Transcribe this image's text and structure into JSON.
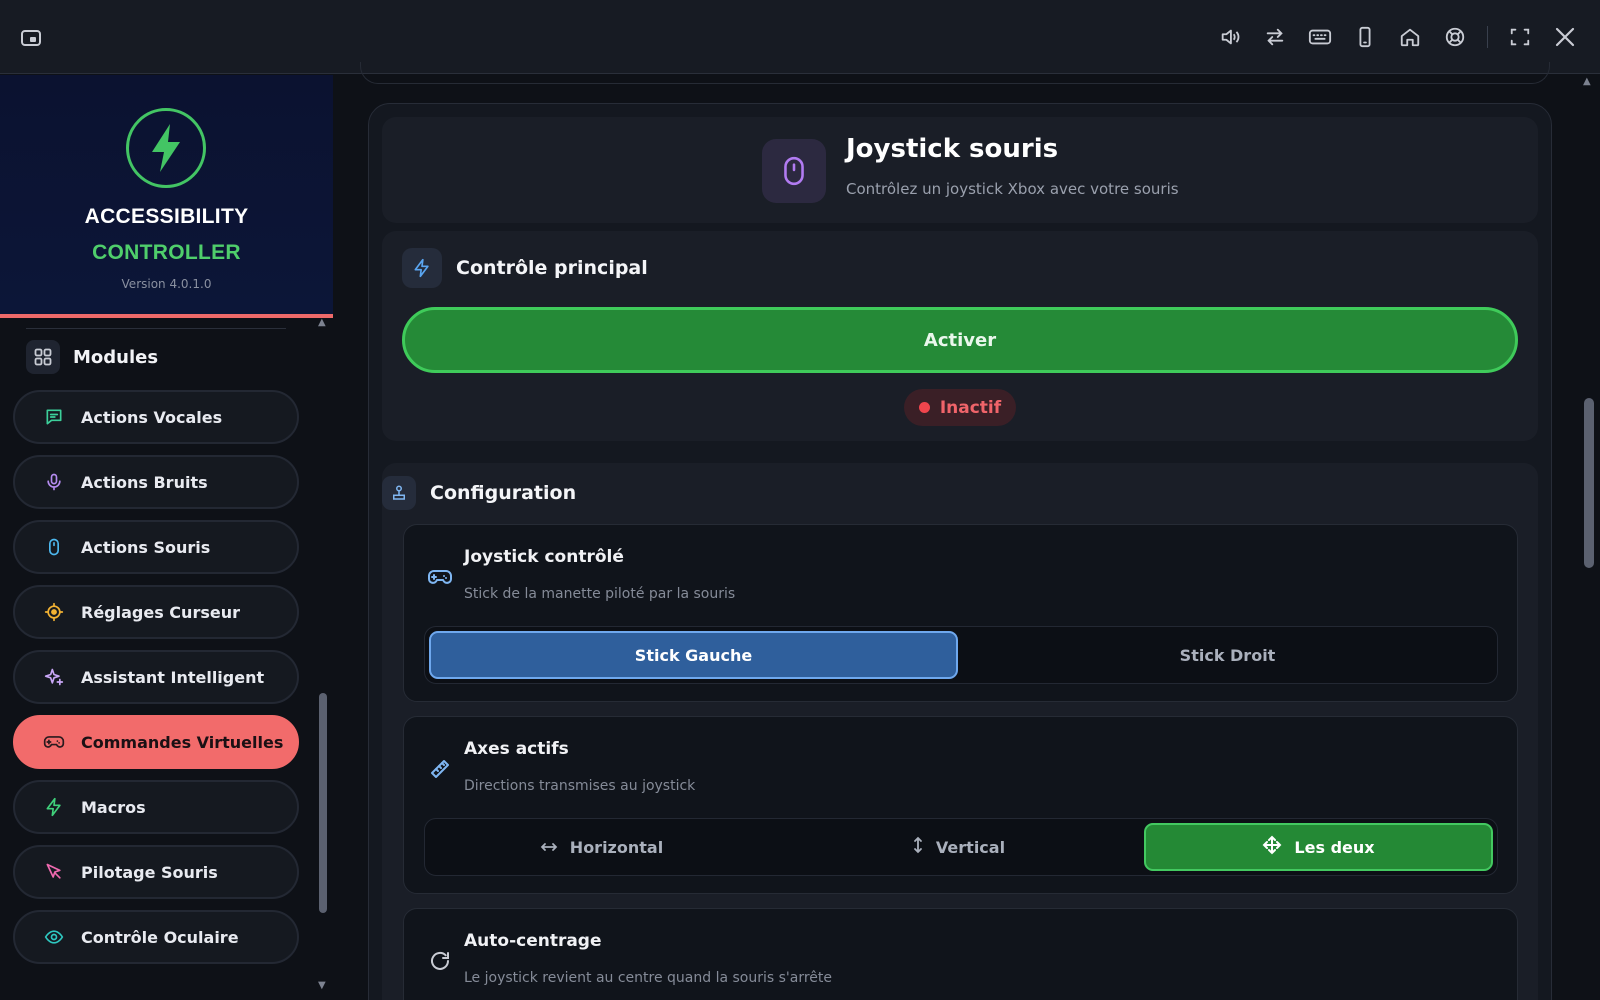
{
  "window": {
    "toolbar_icons": [
      "volume-icon",
      "swap-icon",
      "keyboard-icon",
      "phone-icon",
      "home-icon",
      "lifebuoy-icon",
      "fullscreen-icon",
      "close-icon"
    ]
  },
  "brand": {
    "title_line1": "ACCESSIBILITY",
    "title_line2": "CONTROLLER",
    "version": "Version 4.0.1.0",
    "accent": "#4fce6b"
  },
  "sidebar": {
    "section_label": "Modules",
    "items": [
      {
        "label": "Actions Vocales",
        "icon": "chat-icon",
        "icon_color": "#3ccf9a",
        "active": false
      },
      {
        "label": "Actions Bruits",
        "icon": "microphone-icon",
        "icon_color": "#b58cf0",
        "active": false
      },
      {
        "label": "Actions Souris",
        "icon": "mouse-icon",
        "icon_color": "#4db8ef",
        "active": false
      },
      {
        "label": "Réglages Curseur",
        "icon": "crosshair-icon",
        "icon_color": "#f2b233",
        "active": false
      },
      {
        "label": "Assistant Intelligent",
        "icon": "sparkles-icon",
        "icon_color": "#c9a7f7",
        "active": false
      },
      {
        "label": "Commandes Virtuelles",
        "icon": "gamepad-icon",
        "icon_color": "#2a1a1e",
        "active": true
      },
      {
        "label": "Macros",
        "icon": "bolt-icon",
        "icon_color": "#3fd07a",
        "active": false
      },
      {
        "label": "Pilotage Souris",
        "icon": "cursor-icon",
        "icon_color": "#f06ab0",
        "active": false
      },
      {
        "label": "Contrôle Oculaire",
        "icon": "eye-icon",
        "icon_color": "#2ec7c0",
        "active": false
      }
    ]
  },
  "header": {
    "title": "Joystick souris",
    "subtitle": "Contrôlez un joystick Xbox avec votre souris",
    "icon": "mouse-icon"
  },
  "main_control": {
    "title": "Contrôle principal",
    "activate_label": "Activer",
    "status_label": "Inactif",
    "status_color": "#f0454d"
  },
  "configuration": {
    "title": "Configuration",
    "joystick": {
      "title": "Joystick contrôlé",
      "description": "Stick de la manette piloté par la souris",
      "options": [
        "Stick Gauche",
        "Stick Droit"
      ],
      "selected": "Stick Gauche"
    },
    "axes": {
      "title": "Axes actifs",
      "description": "Directions transmises au joystick",
      "options": [
        "Horizontal",
        "Vertical",
        "Les deux"
      ],
      "selected": "Les deux"
    },
    "autocenter": {
      "title": "Auto-centrage",
      "description": "Le joystick revient au centre quand la souris s'arrête"
    }
  }
}
